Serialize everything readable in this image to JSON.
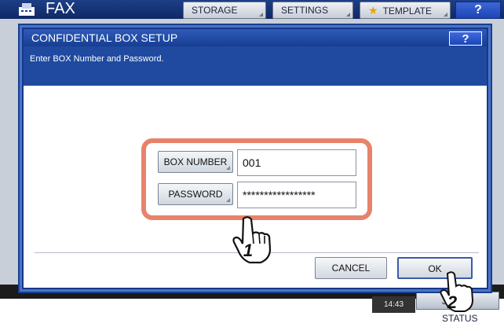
{
  "app": {
    "title": "FAX",
    "tabs": {
      "storage": "STORAGE",
      "settings": "SETTINGS",
      "template": "TEMPLATE"
    },
    "help_label": "?",
    "job_status_label": "JOB STATUS",
    "time": "14:43"
  },
  "dialog": {
    "title": "CONFIDENTIAL BOX SETUP",
    "help_label": "?",
    "instruction": "Enter BOX Number and Password.",
    "fields": {
      "box_number": {
        "label": "BOX NUMBER",
        "value": "001"
      },
      "password": {
        "label": "PASSWORD",
        "value": "*****************"
      }
    },
    "buttons": {
      "cancel": "CANCEL",
      "ok": "OK"
    }
  },
  "annotations": {
    "step1": "1",
    "step2": "2",
    "highlight_color": "#e8826b"
  },
  "colors": {
    "title_bar": "#173e92",
    "instruction_bar": "#1f4aa0",
    "accent": "#e8826b"
  }
}
